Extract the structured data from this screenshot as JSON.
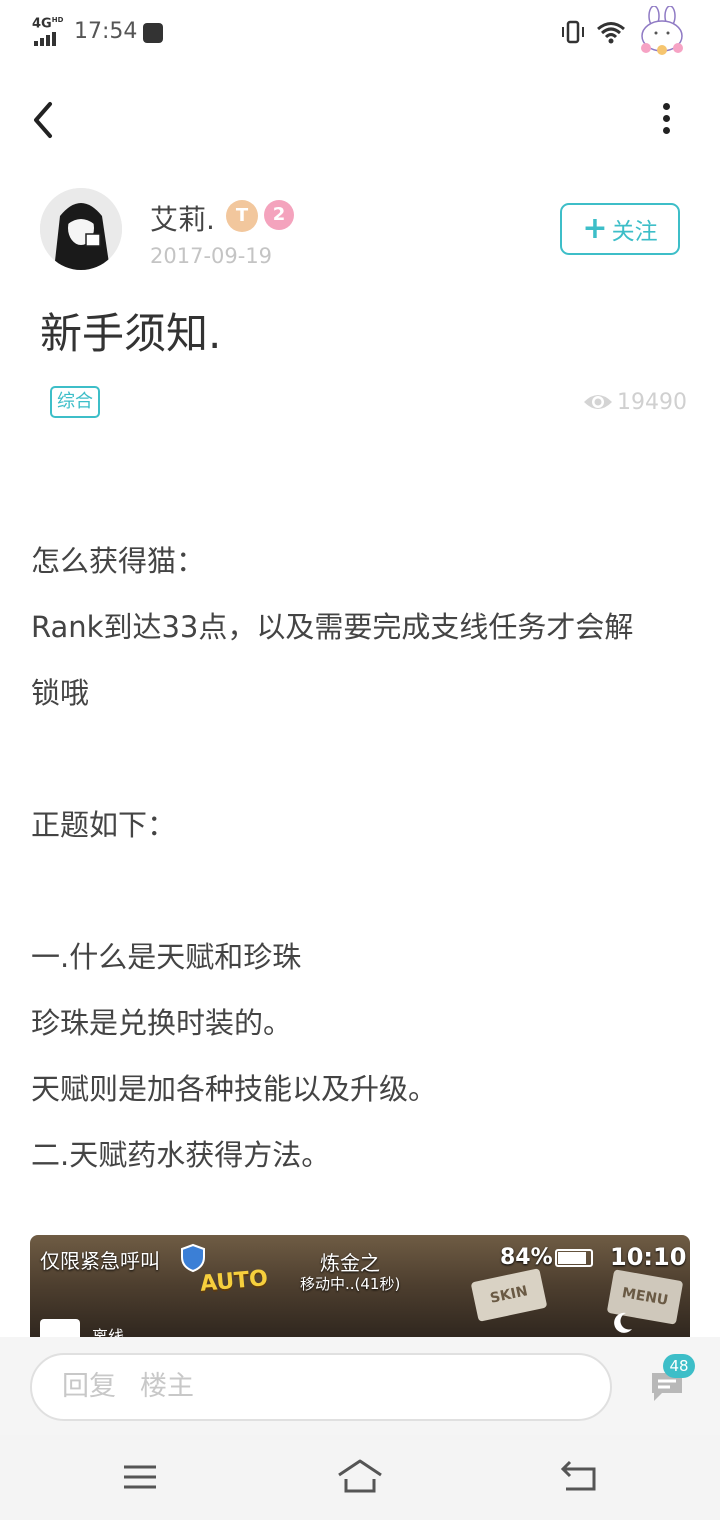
{
  "status_bar": {
    "network": "4G",
    "network_sup": "HD",
    "time": "17:54"
  },
  "author": {
    "name": "艾莉.",
    "badge_level": "T",
    "badge_rank": "2",
    "date": "2017-09-19"
  },
  "follow_button": {
    "label": "关注"
  },
  "post": {
    "title": "新手须知.",
    "tag": "综合",
    "views": "19490",
    "body": [
      "怎么获得猫：",
      "Rank到达33点，以及需要完成支线任务才会解",
      "锁哦",
      "正题如下：",
      "一.什么是天赋和珍珠",
      "珍珠是兑换时装的。",
      "天赋则是加各种技能以及升级。",
      "二.天赋药水获得方法。"
    ]
  },
  "embedded_image": {
    "status_text": "仅限紧急呼叫",
    "auto_label": "AUTO",
    "game_title": "炼金之",
    "game_status": "移动中..(41秒)",
    "battery": "84%",
    "clock": "10:10",
    "skin_label": "SKIN",
    "menu_label": "MENU",
    "offline_label": "离线"
  },
  "reply": {
    "placeholder_prefix": "回复",
    "placeholder_target": "楼主",
    "comment_count": "48"
  },
  "colors": {
    "accent": "#3dbec8",
    "muted": "#c4c4c4"
  },
  "icons": [
    "back-icon",
    "more-icon",
    "eye-icon",
    "comment-icon",
    "nav-menu-icon",
    "nav-home-icon",
    "nav-back-icon"
  ]
}
